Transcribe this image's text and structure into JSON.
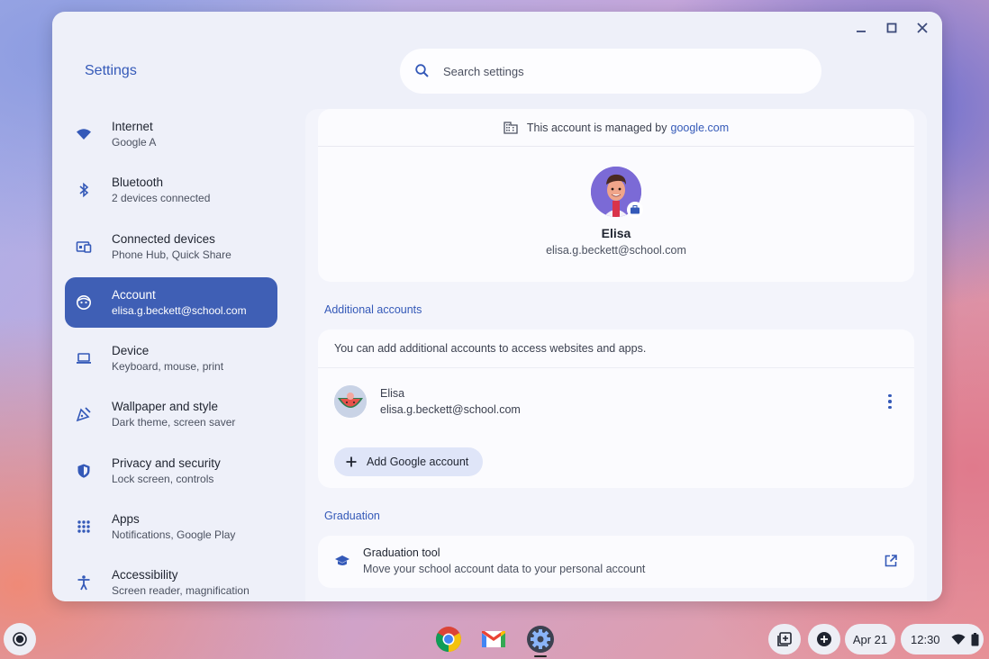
{
  "window": {
    "app_title": "Settings"
  },
  "search": {
    "placeholder": "Search settings"
  },
  "sidebar": {
    "items": [
      {
        "label": "Internet",
        "sub": "Google A",
        "icon": "wifi-icon"
      },
      {
        "label": "Bluetooth",
        "sub": "2 devices connected",
        "icon": "bluetooth-icon"
      },
      {
        "label": "Connected devices",
        "sub": "Phone Hub, Quick Share",
        "icon": "connected-devices-icon"
      },
      {
        "label": "Account",
        "sub": "elisa.g.beckett@school.com",
        "icon": "account-icon",
        "active": true
      },
      {
        "label": "Device",
        "sub": "Keyboard, mouse, print",
        "icon": "laptop-icon"
      },
      {
        "label": "Wallpaper and style",
        "sub": "Dark theme, screen saver",
        "icon": "palette-icon"
      },
      {
        "label": "Privacy and security",
        "sub": "Lock screen, controls",
        "icon": "shield-icon"
      },
      {
        "label": "Apps",
        "sub": "Notifications, Google Play",
        "icon": "apps-grid-icon"
      },
      {
        "label": "Accessibility",
        "sub": "Screen reader, magnification",
        "icon": "accessibility-icon"
      }
    ]
  },
  "profile": {
    "managed_prefix": "This account is managed by",
    "managed_domain": "google.com",
    "name": "Elisa",
    "email": "elisa.g.beckett@school.com"
  },
  "additional_accounts": {
    "title": "Additional accounts",
    "description": "You can add additional accounts to access websites and apps.",
    "account": {
      "name": "Elisa",
      "email": "elisa.g.beckett@school.com"
    },
    "add_button": "Add Google account"
  },
  "graduation": {
    "title": "Graduation",
    "tool_title": "Graduation tool",
    "tool_sub": "Move your school account data to your personal account"
  },
  "shelf": {
    "apps": [
      "chrome-icon",
      "gmail-icon",
      "settings-gear-icon"
    ],
    "date": "Apr 21",
    "time": "12:30"
  },
  "colors": {
    "accent": "#3F5FB5",
    "link": "#3459B8"
  }
}
